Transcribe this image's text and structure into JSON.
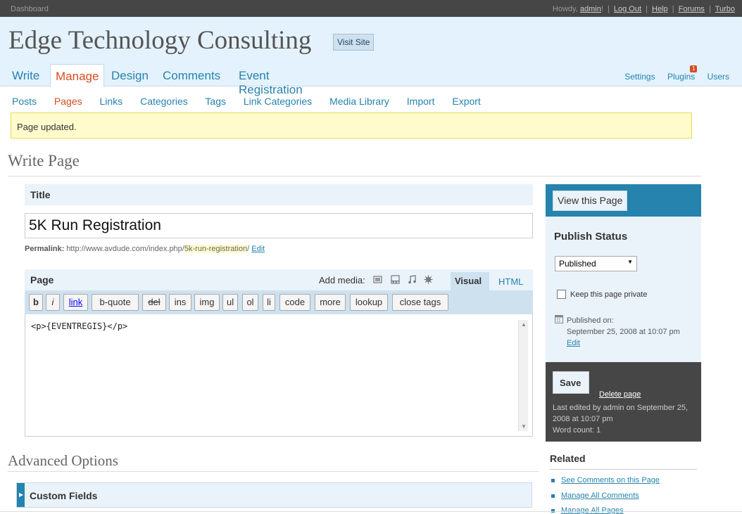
{
  "topbar": {
    "dashboard": "Dashboard",
    "howdy": "Howdy,",
    "user": "admin",
    "exclaim": "!",
    "links": [
      "Log Out",
      "Help",
      "Forums",
      "Turbo"
    ]
  },
  "header": {
    "site_title": "Edge Technology Consulting",
    "visit_site": "Visit Site",
    "main_nav": [
      "Write",
      "Manage",
      "Design",
      "Comments",
      "Event Registration"
    ],
    "right_nav": [
      "Settings",
      "Plugins",
      "Users"
    ],
    "plugins_badge": "1"
  },
  "sub_nav": [
    "Posts",
    "Pages",
    "Links",
    "Categories",
    "Tags",
    "Link Categories",
    "Media Library",
    "Import",
    "Export"
  ],
  "notice": "Page updated.",
  "page_heading": "Write Page",
  "title_box": {
    "label": "Title",
    "value": "5K Run Registration"
  },
  "permalink": {
    "label": "Permalink:",
    "base": "http://www.avdude.com/index.php/",
    "slug": "5k-run-registration",
    "trail": "/",
    "edit": "Edit"
  },
  "editor": {
    "label": "Page",
    "add_media": "Add media:",
    "tab_visual": "Visual",
    "tab_html": "HTML",
    "buttons": [
      "b",
      "i",
      "link",
      "b-quote",
      "del",
      "ins",
      "img",
      "ul",
      "ol",
      "li",
      "code",
      "more",
      "lookup",
      "close tags"
    ],
    "content": "<p>{EVENTREGIS}</p>"
  },
  "advanced": {
    "heading": "Advanced Options",
    "custom_fields": "Custom Fields"
  },
  "sidebar": {
    "view_page": "View this Page",
    "publish_status": "Publish Status",
    "status_value": "Published",
    "keep_private": "Keep this page private",
    "published_on": "Published on:",
    "published_date": "September 25, 2008 at 10:07 pm",
    "edit": "Edit",
    "save": "Save",
    "delete_page": "Delete page",
    "last_edited": "Last edited by admin on September 25, 2008 at 10:07 pm",
    "word_count": "Word count: 1",
    "related_title": "Related",
    "related_links": [
      "See Comments on this Page",
      "Manage All Comments",
      "Manage All Pages"
    ]
  }
}
